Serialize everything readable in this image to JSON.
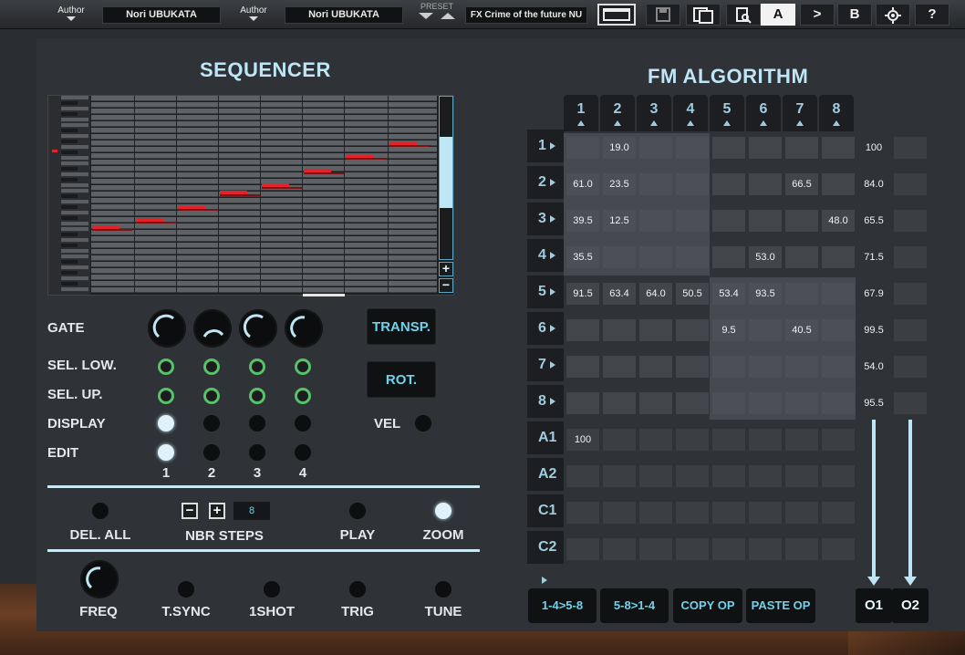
{
  "toolbar": {
    "author_label_1": "Author",
    "author_value_1": "Nori UBUKATA",
    "author_label_2": "Author",
    "author_value_2": "Nori UBUKATA",
    "preset_label": "PRESET",
    "preset_name": "FX Crime of the future NU",
    "btn_a": "A",
    "btn_copy": ">",
    "btn_b": "B",
    "btn_help": "?"
  },
  "sequencer": {
    "title": "SEQUENCER",
    "gate_label": "GATE",
    "sel_low_label": "SEL. LOW.",
    "sel_up_label": "SEL. UP.",
    "display_label": "DISPLAY",
    "edit_label": "EDIT",
    "lanes": [
      "1",
      "2",
      "3",
      "4"
    ],
    "transp_label": "TRANSP.",
    "rot_label": "ROT.",
    "vel_label": "VEL",
    "del_all_label": "DEL. ALL",
    "nbr_steps_label": "NBR STEPS",
    "nbr_steps_value": "8",
    "play_label": "PLAY",
    "zoom_label": "ZOOM",
    "freq_label": "FREQ",
    "tsync_label": "T.SYNC",
    "oneshot_label": "1SHOT",
    "trig_label": "TRIG",
    "tune_label": "TUNE",
    "plus": "+",
    "minus": "−"
  },
  "fm": {
    "title": "FM ALGORITHM",
    "columns": [
      "1",
      "2",
      "3",
      "4",
      "5",
      "6",
      "7",
      "8"
    ],
    "rows": [
      "1",
      "2",
      "3",
      "4",
      "5",
      "6",
      "7",
      "8",
      "A1",
      "A2",
      "C1",
      "C2"
    ],
    "matrix": [
      [
        "",
        "19.0",
        "",
        "",
        "",
        "",
        "",
        ""
      ],
      [
        "61.0",
        "23.5",
        "",
        "",
        "",
        "",
        "66.5",
        ""
      ],
      [
        "39.5",
        "12.5",
        "",
        "",
        "",
        "",
        "",
        "48.0"
      ],
      [
        "35.5",
        "",
        "",
        "",
        "",
        "53.0",
        "",
        ""
      ],
      [
        "91.5",
        "63.4",
        "64.0",
        "50.5",
        "53.4",
        "93.5",
        "",
        ""
      ],
      [
        "",
        "",
        "",
        "",
        "9.5",
        "",
        "40.5",
        ""
      ],
      [
        "",
        "",
        "",
        "",
        "",
        "",
        "",
        ""
      ],
      [
        "",
        "",
        "",
        "",
        "",
        "",
        "",
        ""
      ],
      [
        "100",
        "",
        "",
        "",
        "",
        "",
        "",
        ""
      ],
      [
        "",
        "",
        "",
        "",
        "",
        "",
        "",
        ""
      ],
      [
        "",
        "",
        "",
        "",
        "",
        "",
        "",
        ""
      ],
      [
        "",
        "",
        "",
        "",
        "",
        "",
        "",
        ""
      ]
    ],
    "out1": [
      "100",
      "84.0",
      "65.5",
      "71.5",
      "67.9",
      "99.5",
      "54.0",
      "95.5"
    ],
    "btn_14_58": "1-4>5-8",
    "btn_58_14": "5-8>1-4",
    "btn_copy_op": "COPY OP",
    "btn_paste_op": "PASTE OP",
    "o1": "O1",
    "o2": "O2"
  }
}
